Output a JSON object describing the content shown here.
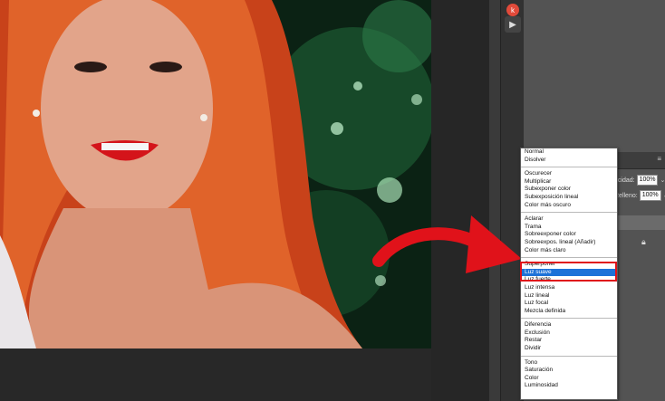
{
  "blend_mode_menu": {
    "groups": [
      [
        "Normal",
        "Disolver"
      ],
      [
        "Oscurecer",
        "Multiplicar",
        "Subexponer color",
        "Subexposición lineal",
        "Color más oscuro"
      ],
      [
        "Aclarar",
        "Trama",
        "Sobreexponer color",
        "Sobreexpos. lineal (Añadir)",
        "Color más claro"
      ],
      [
        "Superponer",
        "Luz suave",
        "Luz fuerte",
        "Luz intensa",
        "Luz lineal",
        "Luz focal",
        "Mezcla definida"
      ],
      [
        "Diferencia",
        "Exclusión",
        "Restar",
        "Dividir"
      ],
      [
        "Tono",
        "Saturación",
        "Color",
        "Luminosidad"
      ]
    ],
    "selected": "Luz suave"
  },
  "layers_panel": {
    "opacity_label": "acidad:",
    "opacity_value": "100%",
    "fill_label": "Relleno:",
    "fill_value": "100%"
  },
  "colors": {
    "selection": "#1d72d8",
    "highlight": "#e0121a",
    "panel": "#535353"
  },
  "icons": {
    "top_tool": "adobe-k-icon",
    "play": "play-icon",
    "lock": "lock-icon",
    "menu": "panel-menu-icon"
  }
}
